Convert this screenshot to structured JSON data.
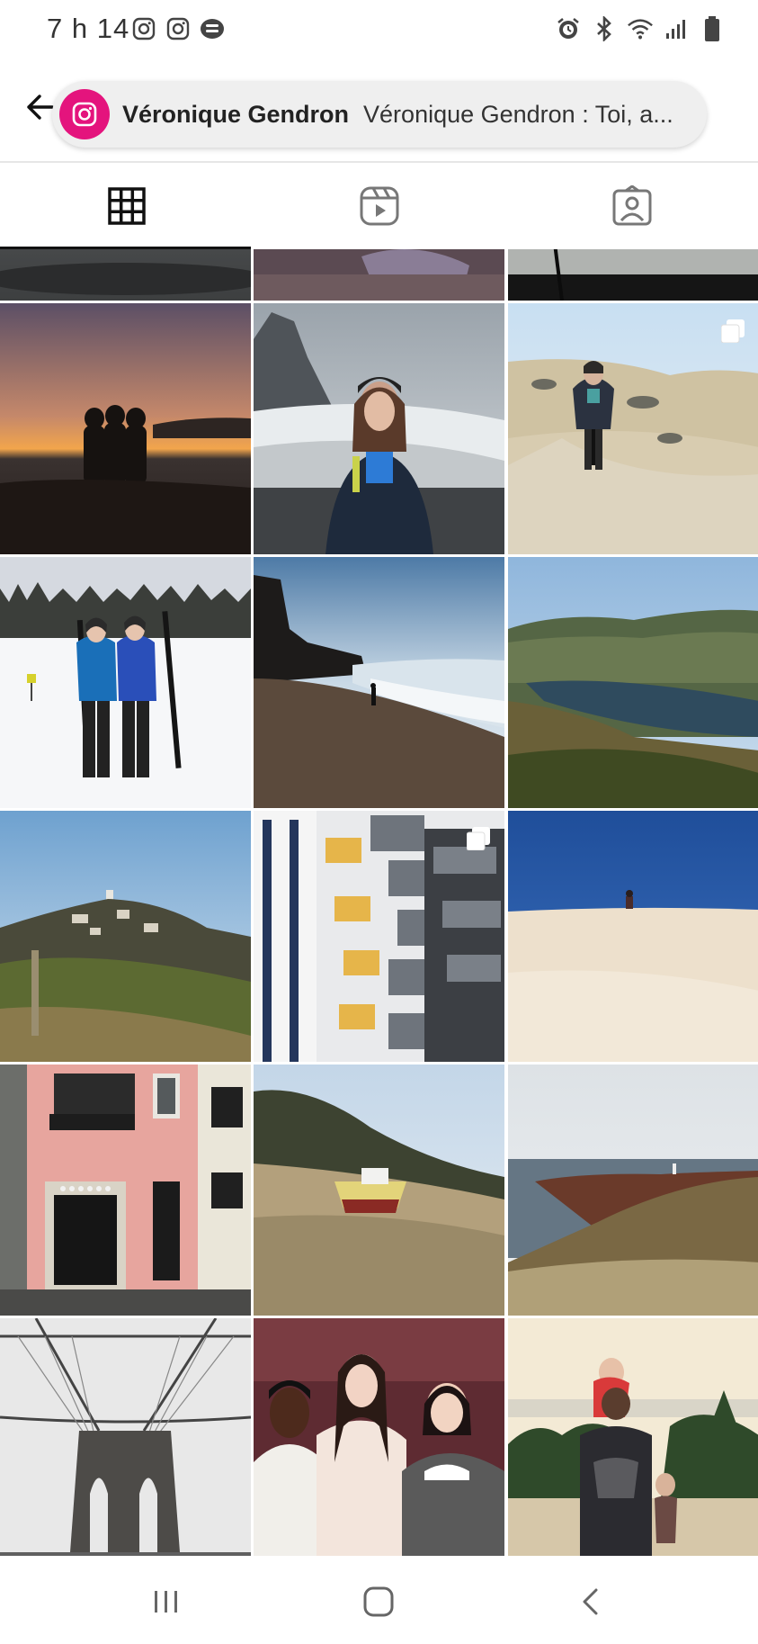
{
  "status_bar": {
    "time": "7 h 14",
    "left_icons": [
      "instagram-icon",
      "instagram-icon",
      "messenger-icon"
    ],
    "right_icons": [
      "alarm-icon",
      "bluetooth-icon",
      "wifi-icon",
      "signal-icon",
      "battery-icon"
    ]
  },
  "header": {
    "profile_name": "Véronique Gendron",
    "caption_preview": "Véronique Gendron : Toi, a...",
    "app_icon": "instagram-icon",
    "back_icon": "back-arrow-icon"
  },
  "tabs": [
    {
      "name": "posts",
      "icon": "grid-icon",
      "active": true
    },
    {
      "name": "reels",
      "icon": "reels-icon",
      "active": false
    },
    {
      "name": "tagged",
      "icon": "tagged-person-icon",
      "active": false
    }
  ],
  "grid_posts": [
    {
      "subject": "partial-dark-sky",
      "multi": false
    },
    {
      "subject": "partial-purple-fabric",
      "multi": false
    },
    {
      "subject": "partial-boat",
      "multi": false
    },
    {
      "subject": "sunset-silhouettes",
      "multi": false
    },
    {
      "subject": "woman-black-sand-beach",
      "multi": false
    },
    {
      "subject": "hiker-on-moor",
      "multi": true
    },
    {
      "subject": "skiers-in-snow",
      "multi": false
    },
    {
      "subject": "person-on-beach-cliff",
      "multi": false
    },
    {
      "subject": "river-valley",
      "multi": false
    },
    {
      "subject": "hilltop-village",
      "multi": false
    },
    {
      "subject": "apartment-balconies",
      "multi": true
    },
    {
      "subject": "sand-dune-blue-sky",
      "multi": false
    },
    {
      "subject": "pink-building-storefront",
      "multi": false
    },
    {
      "subject": "boat-on-hill",
      "multi": false
    },
    {
      "subject": "coastal-cliff",
      "multi": false
    },
    {
      "subject": "brooklyn-bridge",
      "multi": false
    },
    {
      "subject": "three-friends-toasting",
      "multi": false
    },
    {
      "subject": "parent-with-children",
      "multi": false
    }
  ],
  "navbar": {
    "buttons": [
      "recent-apps-icon",
      "home-icon",
      "back-icon"
    ]
  },
  "colors": {
    "instagram_pink": "#e4147d",
    "pill_background": "#efefef"
  }
}
